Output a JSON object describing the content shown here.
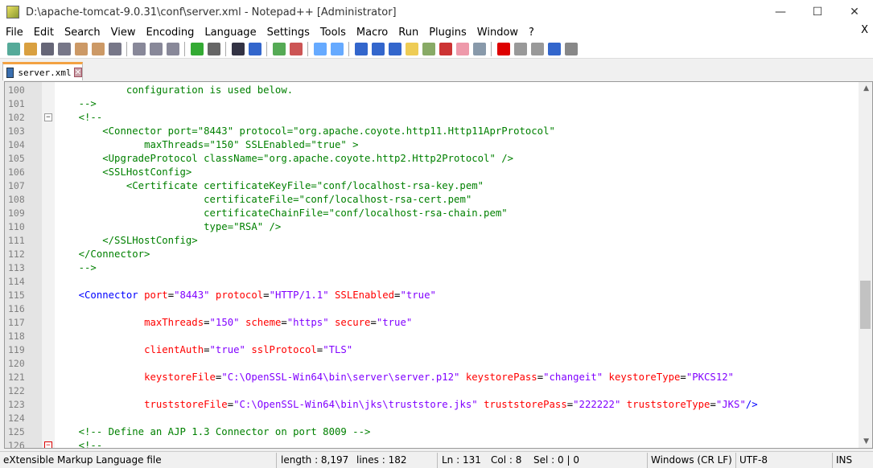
{
  "window": {
    "title": "D:\\apache-tomcat-9.0.31\\conf\\server.xml - Notepad++ [Administrator]",
    "minimize": "—",
    "maximize": "☐",
    "close": "✕"
  },
  "menu": [
    "File",
    "Edit",
    "Search",
    "View",
    "Encoding",
    "Language",
    "Settings",
    "Tools",
    "Macro",
    "Run",
    "Plugins",
    "Window",
    "?"
  ],
  "menu_close": "X",
  "toolbar": [
    "new",
    "open",
    "save",
    "save-all",
    "close",
    "close-all",
    "print",
    "|",
    "cut",
    "copy",
    "paste",
    "|",
    "undo",
    "redo",
    "|",
    "find",
    "replace",
    "|",
    "zoom-in",
    "zoom-out",
    "|",
    "sync-v",
    "sync-h",
    "|",
    "word-wrap",
    "show-all-chars",
    "indent-guide",
    "udl",
    "doc-map",
    "function-list",
    "folder-workspace",
    "monitor",
    "|",
    "record",
    "stop",
    "play",
    "play-multiple",
    "save-macro"
  ],
  "tab": {
    "label": "server.xml",
    "close": "✕"
  },
  "lines": [
    {
      "n": "100",
      "f": "",
      "tokens": [
        [
          "p",
          "            "
        ],
        [
          "c",
          "configuration is used below."
        ]
      ]
    },
    {
      "n": "101",
      "f": "",
      "tokens": [
        [
          "p",
          "    "
        ],
        [
          "c",
          "-->"
        ]
      ]
    },
    {
      "n": "102",
      "f": "-",
      "tokens": [
        [
          "p",
          "    "
        ],
        [
          "c",
          "<!--"
        ]
      ]
    },
    {
      "n": "103",
      "f": "",
      "tokens": [
        [
          "p",
          "        "
        ],
        [
          "c",
          "<Connector port=\"8443\" protocol=\"org.apache.coyote.http11.Http11AprProtocol\""
        ]
      ]
    },
    {
      "n": "104",
      "f": "",
      "tokens": [
        [
          "p",
          "               "
        ],
        [
          "c",
          "maxThreads=\"150\" SSLEnabled=\"true\" >"
        ]
      ]
    },
    {
      "n": "105",
      "f": "",
      "tokens": [
        [
          "p",
          "        "
        ],
        [
          "c",
          "<UpgradeProtocol className=\"org.apache.coyote.http2.Http2Protocol\" />"
        ]
      ]
    },
    {
      "n": "106",
      "f": "",
      "tokens": [
        [
          "p",
          "        "
        ],
        [
          "c",
          "<SSLHostConfig>"
        ]
      ]
    },
    {
      "n": "107",
      "f": "",
      "tokens": [
        [
          "p",
          "            "
        ],
        [
          "c",
          "<Certificate certificateKeyFile=\"conf/localhost-rsa-key.pem\""
        ]
      ]
    },
    {
      "n": "108",
      "f": "",
      "tokens": [
        [
          "p",
          "                         "
        ],
        [
          "c",
          "certificateFile=\"conf/localhost-rsa-cert.pem\""
        ]
      ]
    },
    {
      "n": "109",
      "f": "",
      "tokens": [
        [
          "p",
          "                         "
        ],
        [
          "c",
          "certificateChainFile=\"conf/localhost-rsa-chain.pem\""
        ]
      ]
    },
    {
      "n": "110",
      "f": "",
      "tokens": [
        [
          "p",
          "                         "
        ],
        [
          "c",
          "type=\"RSA\" />"
        ]
      ]
    },
    {
      "n": "111",
      "f": "",
      "tokens": [
        [
          "p",
          "        "
        ],
        [
          "c",
          "</SSLHostConfig>"
        ]
      ]
    },
    {
      "n": "112",
      "f": "",
      "tokens": [
        [
          "p",
          "    "
        ],
        [
          "c",
          "</Connector>"
        ]
      ]
    },
    {
      "n": "113",
      "f": "",
      "tokens": [
        [
          "p",
          "    "
        ],
        [
          "c",
          "-->"
        ]
      ]
    },
    {
      "n": "114",
      "f": "",
      "tokens": []
    },
    {
      "n": "115",
      "f": "",
      "tokens": [
        [
          "p",
          "    "
        ],
        [
          "t",
          "<Connector "
        ],
        [
          "a",
          "port"
        ],
        [
          "p",
          "="
        ],
        [
          "v",
          "\"8443\""
        ],
        [
          "a",
          " protocol"
        ],
        [
          "p",
          "="
        ],
        [
          "v",
          "\"HTTP/1.1\""
        ],
        [
          "a",
          " SSLEnabled"
        ],
        [
          "p",
          "="
        ],
        [
          "v",
          "\"true\""
        ]
      ]
    },
    {
      "n": "116",
      "f": "",
      "tokens": []
    },
    {
      "n": "117",
      "f": "",
      "tokens": [
        [
          "p",
          "               "
        ],
        [
          "a",
          "maxThreads"
        ],
        [
          "p",
          "="
        ],
        [
          "v",
          "\"150\""
        ],
        [
          "a",
          " scheme"
        ],
        [
          "p",
          "="
        ],
        [
          "v",
          "\"https\""
        ],
        [
          "a",
          " secure"
        ],
        [
          "p",
          "="
        ],
        [
          "v",
          "\"true\""
        ]
      ]
    },
    {
      "n": "118",
      "f": "",
      "tokens": []
    },
    {
      "n": "119",
      "f": "",
      "tokens": [
        [
          "p",
          "               "
        ],
        [
          "a",
          "clientAuth"
        ],
        [
          "p",
          "="
        ],
        [
          "v",
          "\"true\""
        ],
        [
          "a",
          " sslProtocol"
        ],
        [
          "p",
          "="
        ],
        [
          "v",
          "\"TLS\""
        ]
      ]
    },
    {
      "n": "120",
      "f": "",
      "tokens": []
    },
    {
      "n": "121",
      "f": "",
      "tokens": [
        [
          "p",
          "               "
        ],
        [
          "a",
          "keystoreFile"
        ],
        [
          "p",
          "="
        ],
        [
          "v",
          "\"C:\\OpenSSL-Win64\\bin\\server\\server.p12\""
        ],
        [
          "a",
          " keystorePass"
        ],
        [
          "p",
          "="
        ],
        [
          "v",
          "\"changeit\""
        ],
        [
          "a",
          " keystoreType"
        ],
        [
          "p",
          "="
        ],
        [
          "v",
          "\"PKCS12\""
        ]
      ]
    },
    {
      "n": "122",
      "f": "",
      "tokens": []
    },
    {
      "n": "123",
      "f": "",
      "tokens": [
        [
          "p",
          "               "
        ],
        [
          "a",
          "truststoreFile"
        ],
        [
          "p",
          "="
        ],
        [
          "v",
          "\"C:\\OpenSSL-Win64\\bin\\jks\\truststore.jks\""
        ],
        [
          "a",
          " truststorePass"
        ],
        [
          "p",
          "="
        ],
        [
          "v",
          "\"222222\""
        ],
        [
          "a",
          " truststoreType"
        ],
        [
          "p",
          "="
        ],
        [
          "v",
          "\"JKS\""
        ],
        [
          "t",
          "/>"
        ]
      ]
    },
    {
      "n": "124",
      "f": "",
      "tokens": []
    },
    {
      "n": "125",
      "f": "",
      "tokens": [
        [
          "p",
          "    "
        ],
        [
          "c",
          "<!-- Define an AJP 1.3 Connector on port 8009 -->"
        ]
      ]
    },
    {
      "n": "126",
      "f": "red",
      "tokens": [
        [
          "p",
          "    "
        ],
        [
          "c",
          "<!--"
        ]
      ]
    }
  ],
  "status": {
    "type": "eXtensible Markup Language file",
    "length": "length : 8,197",
    "lines": "lines : 182",
    "ln": "Ln : 131",
    "col": "Col : 8",
    "sel": "Sel : 0 | 0",
    "eol": "Windows (CR LF)",
    "encoding": "UTF-8",
    "mode": "INS"
  }
}
